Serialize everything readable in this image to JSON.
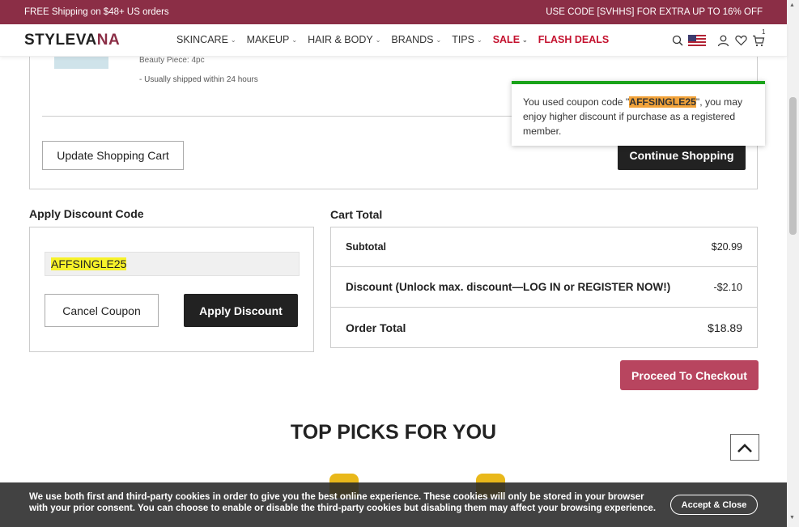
{
  "promo": {
    "left": "FREE Shipping on $48+ US orders",
    "right": "USE CODE [SVHHS] FOR EXTRA UP TO 16% OFF"
  },
  "nav": {
    "logo_main": "STYLEVA",
    "logo_accent": "NA",
    "menu": [
      {
        "label": "SKINCARE",
        "chevron": true
      },
      {
        "label": "MAKEUP",
        "chevron": true
      },
      {
        "label": "HAIR & BODY",
        "chevron": true
      },
      {
        "label": "BRANDS",
        "chevron": true
      },
      {
        "label": "TIPS",
        "chevron": true
      },
      {
        "label": "SALE",
        "chevron": true
      },
      {
        "label": "FLASH DEALS",
        "chevron": false
      }
    ],
    "cart_count": "1",
    "icons": [
      "search-icon",
      "us-flag-icon",
      "user-icon",
      "heart-icon",
      "cart-icon"
    ]
  },
  "cart": {
    "item_meta": "Beauty Piece: 4pc",
    "item_shipping": "- Usually shipped within 24 hours",
    "update_label": "Update Shopping Cart",
    "continue_label": "Continue Shopping"
  },
  "toast": {
    "prefix": "You used coupon code \"",
    "code": "AFFSINGLE25",
    "suffix": "\", you may enjoy higher discount if purchase as a registered member."
  },
  "discount": {
    "title": "Apply Discount Code",
    "code_value": "AFFSINGLE25",
    "cancel_label": "Cancel Coupon",
    "apply_label": "Apply Discount"
  },
  "totals": {
    "title": "Cart Total",
    "rows": [
      {
        "label": "Subtotal",
        "value": "$20.99"
      },
      {
        "label": "Discount (Unlock max. discount—LOG IN or REGISTER NOW!)",
        "value": "-$2.10"
      },
      {
        "label": "Order Total",
        "value": "$18.89"
      }
    ]
  },
  "checkout_label": "Proceed To Checkout",
  "top_picks_title": "TOP PICKS FOR YOU",
  "cookie": {
    "text": "We use both first and third-party cookies in order to give you the best online experience. These cookies will only be stored in your browser with your prior consent. You can choose to enable or disable the third-party cookies but disabling them may affect your browsing experience.",
    "button": "Accept & Close"
  },
  "colors": {
    "brand": "#8b2e46",
    "sale": "#c4122f",
    "checkout": "#b8455f",
    "toast_border": "#1aa31a",
    "code_highlight": "#f7f22a"
  }
}
